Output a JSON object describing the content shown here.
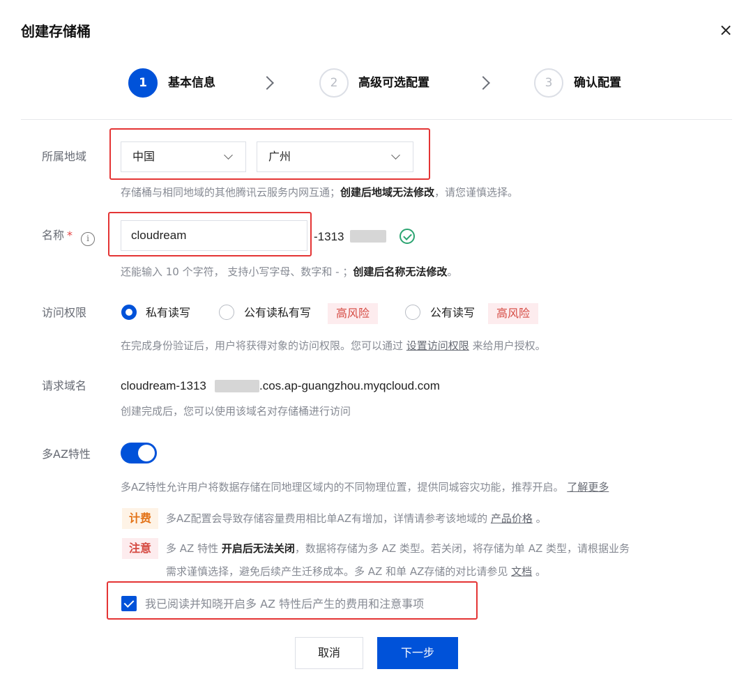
{
  "dialog": {
    "title": "创建存储桶",
    "close_icon": "×"
  },
  "steps": [
    {
      "number": "1",
      "label": "基本信息"
    },
    {
      "number": "2",
      "label": "高级可选配置"
    },
    {
      "number": "3",
      "label": "确认配置"
    }
  ],
  "region": {
    "label": "所属地域",
    "country": "中国",
    "city": "广州",
    "hint_prefix": "存储桶与相同地域的其他腾讯云服务内网互通；",
    "hint_bold": "创建后地域无法修改",
    "hint_suffix": "，请您谨慎选择。"
  },
  "name": {
    "label": "名称",
    "required_mark": "*",
    "info_icon": "i",
    "value": "cloudream",
    "suffix": "-1313",
    "hint_prefix": "还能输入 10 个字符， 支持小写字母、数字和 - ；",
    "hint_bold": "创建后名称无法修改",
    "hint_suffix": "。"
  },
  "access": {
    "label": "访问权限",
    "options": [
      {
        "label": "私有读写",
        "selected": true
      },
      {
        "label": "公有读私有写",
        "selected": false,
        "tag": "高风险"
      },
      {
        "label": "公有读写",
        "selected": false,
        "tag": "高风险"
      }
    ],
    "hint_prefix": "在完成身份验证后，用户将获得对象的访问权限。您可以通过 ",
    "hint_link": "设置访问权限",
    "hint_suffix": " 来给用户授权。"
  },
  "domain": {
    "label": "请求域名",
    "prefix": "cloudream-1313",
    "suffix": ".cos.ap-guangzhou.myqcloud.com",
    "hint": "创建完成后，您可以使用该域名对存储桶进行访问"
  },
  "multi_az": {
    "label": "多AZ特性",
    "enabled": true,
    "desc": "多AZ特性允许用户将数据存储在同地理区域内的不同物理位置，提供同城容灾功能，推荐开启。",
    "learn_more": "了解更多",
    "fee_tag": "计费",
    "fee_text": "多AZ配置会导致存储容量费用相比单AZ有增加，详情请参考该地域的",
    "fee_link": "产品价格",
    "fee_end": "。",
    "note_tag": "注意",
    "note_prefix": "多 AZ 特性 ",
    "note_bold": "开启后无法关闭",
    "note_line1": "，数据将存储为多 AZ 类型。若关闭，将存储为单 AZ 类型，请根据业务",
    "note_line2": "需求谨慎选择，避免后续产生迁移成本。多 AZ 和单 AZ存储的对比请参见",
    "note_link": "文档",
    "note_end": "。",
    "ack_label": "我已阅读并知晓开启多 AZ 特性后产生的费用和注意事项",
    "ack_checked": true
  },
  "footer": {
    "cancel_label": "取消",
    "next_label": "下一步"
  },
  "colors": {
    "primary": "#0052d9",
    "danger": "#d54941",
    "warning": "#e37318",
    "success": "#2ba471",
    "highlight": "#e43434"
  }
}
